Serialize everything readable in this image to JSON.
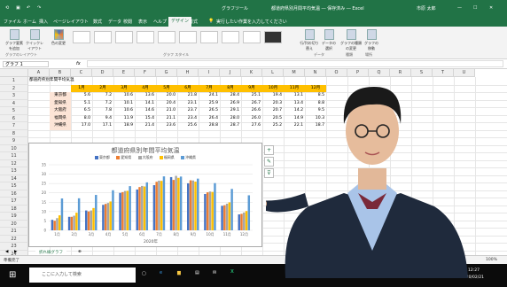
{
  "titlebar": {
    "left_tool": "グラフツール",
    "title": "都道府県別月間平均気温 ― 保存済み ― Excel",
    "user": "市原 太郎"
  },
  "tabs": [
    "ファイル",
    "ホーム",
    "挿入",
    "ページレイアウト",
    "数式",
    "データ",
    "校閲",
    "表示",
    "ヘルプ",
    "デザイン",
    "書式"
  ],
  "active_tab": "デザイン",
  "tell_me": "実行したい作業を入力してください",
  "ribbon": {
    "groups": [
      "グラフのレイアウト",
      "グラフ スタイル",
      "データ",
      "種類",
      "場所"
    ],
    "buttons": [
      "グラフ要素を追加",
      "クイックレイアウト",
      "色の変更",
      "行/列の切り替え",
      "データの選択",
      "グラフの種類の変更",
      "グラフの移動"
    ]
  },
  "namebox": "グラフ 1",
  "fx": "fx",
  "columns": [
    "A",
    "B",
    "C",
    "D",
    "E",
    "F",
    "G",
    "H",
    "I",
    "J",
    "K",
    "L",
    "M",
    "N",
    "O",
    "P",
    "Q",
    "R",
    "S",
    "T",
    "U"
  ],
  "rows": [
    "1",
    "2",
    "3",
    "4",
    "5",
    "6",
    "7",
    "8",
    "9",
    "10",
    "11",
    "12",
    "13",
    "14",
    "15",
    "16",
    "17",
    "18",
    "19",
    "20",
    "21",
    "22",
    "23",
    "24",
    "25"
  ],
  "table": {
    "title": "都道府県別年間平均気温",
    "months": [
      "1月",
      "2月",
      "3月",
      "4月",
      "5月",
      "6月",
      "7月",
      "8月",
      "9月",
      "10月",
      "11月",
      "12月"
    ],
    "rows": [
      {
        "pref": "東京都",
        "vals": [
          "5.6",
          "7.2",
          "10.6",
          "13.6",
          "20.0",
          "21.8",
          "24.1",
          "28.4",
          "25.1",
          "19.4",
          "13.1",
          "8.5"
        ]
      },
      {
        "pref": "愛知県",
        "vals": [
          "5.1",
          "7.2",
          "10.1",
          "14.1",
          "20.4",
          "23.1",
          "25.9",
          "26.9",
          "26.7",
          "20.3",
          "13.4",
          "8.8"
        ]
      },
      {
        "pref": "大阪府",
        "vals": [
          "6.5",
          "7.8",
          "10.6",
          "14.6",
          "21.0",
          "23.7",
          "26.5",
          "29.1",
          "26.6",
          "20.7",
          "14.2",
          "9.5"
        ]
      },
      {
        "pref": "福岡県",
        "vals": [
          "8.0",
          "9.4",
          "11.9",
          "15.4",
          "21.1",
          "23.4",
          "26.4",
          "28.0",
          "26.0",
          "20.5",
          "14.9",
          "10.3"
        ]
      },
      {
        "pref": "沖縄県",
        "vals": [
          "17.0",
          "17.1",
          "18.9",
          "21.4",
          "23.6",
          "25.6",
          "28.8",
          "28.7",
          "27.6",
          "25.2",
          "22.1",
          "18.7"
        ]
      }
    ]
  },
  "chart_data": {
    "type": "bar",
    "title": "都道府県別年間平均気温",
    "xlabel": "2020年",
    "categories": [
      "1月",
      "2月",
      "3月",
      "4月",
      "5月",
      "6月",
      "7月",
      "8月",
      "9月",
      "10月",
      "11月",
      "12月"
    ],
    "yticks": [
      "35",
      "30",
      "25",
      "20",
      "15",
      "10",
      "5",
      "0"
    ],
    "ylim": [
      0,
      35
    ],
    "series": [
      {
        "name": "東京都",
        "color": "#4472c4",
        "values": [
          5.6,
          7.2,
          10.6,
          13.6,
          20.0,
          21.8,
          24.1,
          28.4,
          25.1,
          19.4,
          13.1,
          8.5
        ]
      },
      {
        "name": "愛知県",
        "color": "#ed7d31",
        "values": [
          5.1,
          7.2,
          10.1,
          14.1,
          20.4,
          23.1,
          25.9,
          26.9,
          26.7,
          20.3,
          13.4,
          8.8
        ]
      },
      {
        "name": "大阪府",
        "color": "#a5a5a5",
        "values": [
          6.5,
          7.8,
          10.6,
          14.6,
          21.0,
          23.7,
          26.5,
          29.1,
          26.6,
          20.7,
          14.2,
          9.5
        ]
      },
      {
        "name": "福岡県",
        "color": "#ffc000",
        "values": [
          8.0,
          9.4,
          11.9,
          15.4,
          21.1,
          23.4,
          26.4,
          28.0,
          26.0,
          20.5,
          14.9,
          10.3
        ]
      },
      {
        "name": "沖縄県",
        "color": "#5b9bd5",
        "values": [
          17.0,
          17.1,
          18.9,
          21.4,
          23.6,
          25.6,
          28.8,
          28.7,
          27.6,
          25.2,
          22.1,
          18.7
        ]
      }
    ]
  },
  "sheet_tab": "折れ線グラフ",
  "status": {
    "left": "準備完了",
    "avg": "平均: 18.39666...",
    "zoom": "100%"
  },
  "taskbar": {
    "search": "ここに入力して検索",
    "time": "12:27",
    "date": "2020/02/21"
  }
}
